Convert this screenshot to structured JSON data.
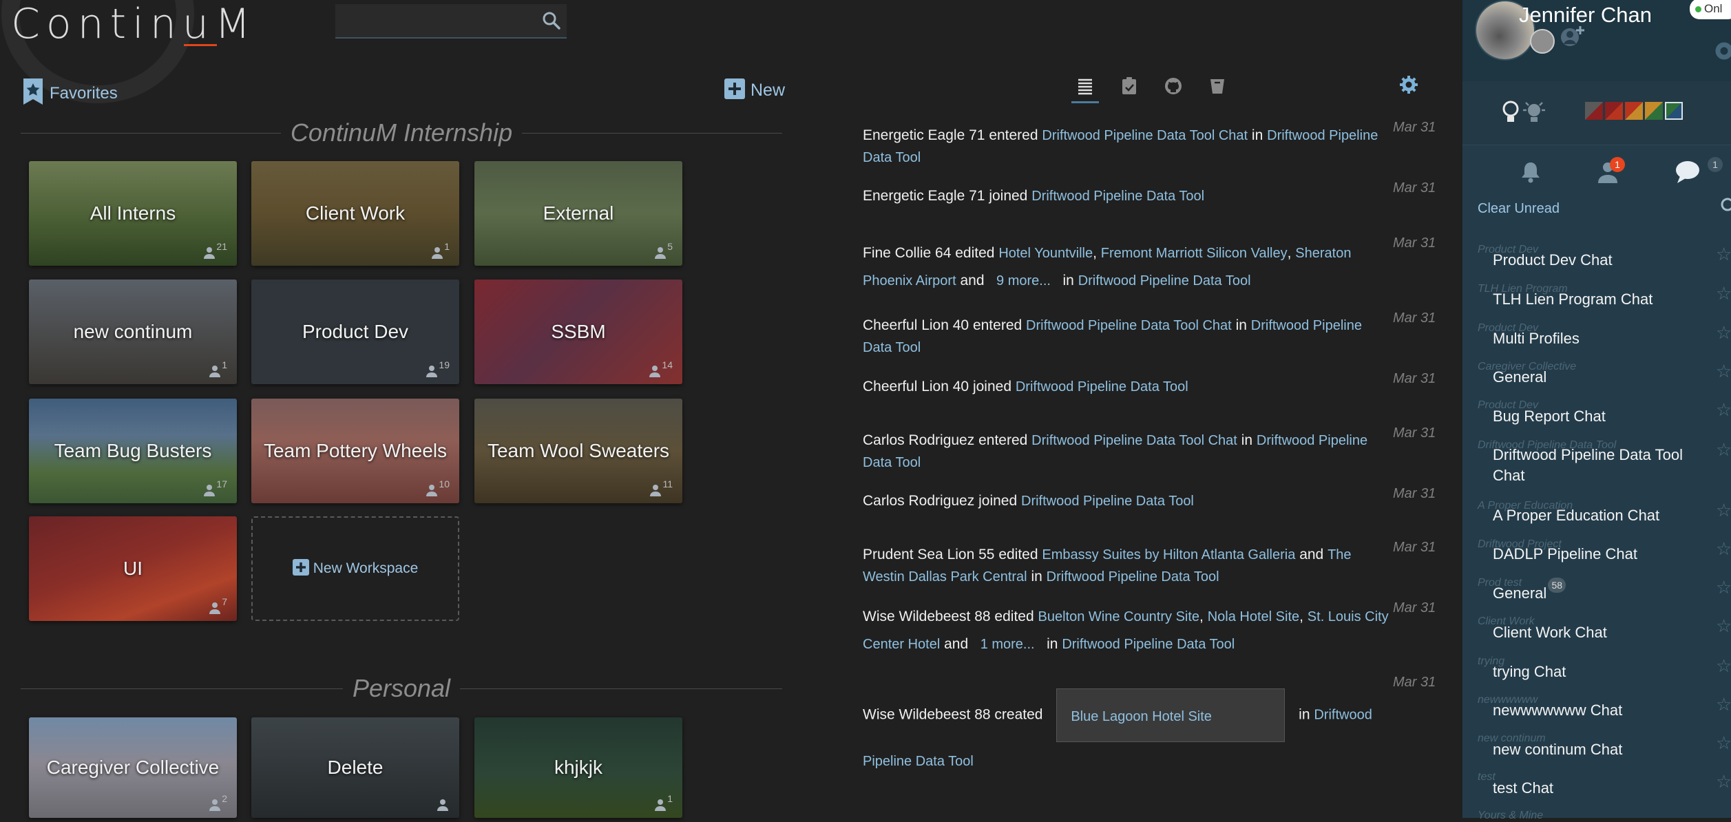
{
  "app": {
    "logo_text": "ContinuM"
  },
  "search": {
    "placeholder": ""
  },
  "left": {
    "favorites_label": "Favorites",
    "new_label": "New",
    "section_internship": "ContinuM Internship",
    "section_personal": "Personal",
    "new_workspace_label": "New Workspace",
    "tiles": [
      {
        "name": "All Interns",
        "members": "21"
      },
      {
        "name": "Client Work",
        "members": "1"
      },
      {
        "name": "External",
        "members": "5"
      },
      {
        "name": "new continum",
        "members": "1"
      },
      {
        "name": "Product Dev",
        "members": "19"
      },
      {
        "name": "SSBM",
        "members": "14"
      },
      {
        "name": "Team Bug Busters",
        "members": "17"
      },
      {
        "name": "Team Pottery Wheels",
        "members": "10"
      },
      {
        "name": "Team Wool Sweaters",
        "members": "11"
      },
      {
        "name": "UI",
        "members": "7"
      }
    ],
    "personal_tiles": [
      {
        "name": "Caregiver Collective",
        "members": "2"
      },
      {
        "name": "Delete",
        "members": ""
      },
      {
        "name": "khjkjk",
        "members": "1"
      }
    ]
  },
  "feed": {
    "entries": [
      {
        "date": "Mar 31",
        "actor": "Energetic Eagle 71",
        "verb": "entered",
        "target": "Driftwood Pipeline Data Tool Chat",
        "in": "in",
        "place": "Driftwood Pipeline Data Tool"
      },
      {
        "date": "Mar 31",
        "actor": "Energetic Eagle 71",
        "verb": "joined",
        "target": "Driftwood Pipeline Data Tool"
      },
      {
        "date": "Mar 31",
        "actor": "Fine Collie 64",
        "verb": "edited",
        "items": [
          "Hotel Yountville",
          "Fremont Marriott Silicon Valley",
          "Sheraton Phoenix Airport"
        ],
        "and": "and",
        "more": "9 more...",
        "in": "in",
        "place": "Driftwood Pipeline Data Tool"
      },
      {
        "date": "Mar 31",
        "actor": "Cheerful Lion 40",
        "verb": "entered",
        "target": "Driftwood Pipeline Data Tool Chat",
        "in": "in",
        "place": "Driftwood Pipeline Data Tool"
      },
      {
        "date": "Mar 31",
        "actor": "Cheerful Lion 40",
        "verb": "joined",
        "target": "Driftwood Pipeline Data Tool"
      },
      {
        "date": "Mar 31",
        "actor": "Carlos Rodriguez",
        "verb": "entered",
        "target": "Driftwood Pipeline Data Tool Chat",
        "in": "in",
        "place": "Driftwood Pipeline Data Tool"
      },
      {
        "date": "Mar 31",
        "actor": "Carlos Rodriguez",
        "verb": "joined",
        "target": "Driftwood Pipeline Data Tool"
      },
      {
        "date": "Mar 31",
        "actor": "Prudent Sea Lion 55",
        "verb": "edited",
        "items": [
          "Embassy Suites by Hilton Atlanta Galleria",
          "The Westin Dallas Park Central"
        ],
        "and": "and",
        "in": "in",
        "place": "Driftwood Pipeline Data Tool"
      },
      {
        "date": "Mar 31",
        "actor": "Wise Wildebeest 88",
        "verb": "edited",
        "items": [
          "Buelton Wine Country Site",
          "Nola Hotel Site",
          "St. Louis City Center Hotel"
        ],
        "and": "and",
        "more": "1 more...",
        "in": "in",
        "place": "Driftwood Pipeline Data Tool"
      },
      {
        "date": "Mar 31",
        "actor": "Wise Wildebeest 88",
        "verb": "created",
        "target": "Blue Lagoon Hotel Site",
        "in": "in",
        "place": "Driftwood Pipeline Data Tool"
      }
    ]
  },
  "user": {
    "name": "Jennifer Chan",
    "status": "Onl"
  },
  "panel": {
    "clear_unread": "Clear Unread",
    "people_badge": "1",
    "chat_badge": "1",
    "swatch_colors": [
      "#5a5a5a",
      "#8c1f1f",
      "#b8341e",
      "#c58b2a",
      "#2f6f3a",
      "#244f77"
    ],
    "chats": [
      {
        "sub": "Product Dev",
        "name": "Product Dev Chat"
      },
      {
        "sub": "TLH Lien Program",
        "name": "TLH Lien Program Chat"
      },
      {
        "sub": "Product Dev",
        "name": "Multi Profiles"
      },
      {
        "sub": "Caregiver Collective",
        "name": "General"
      },
      {
        "sub": "Product Dev",
        "name": "Bug Report Chat"
      },
      {
        "sub": "Driftwood Pipeline Data Tool",
        "name": "Driftwood Pipeline Data Tool Chat"
      },
      {
        "sub": "A Proper Education",
        "name": "A Proper Education Chat"
      },
      {
        "sub": "Driftwood Project",
        "name": "DADLP Pipeline Chat"
      },
      {
        "sub": "Prod test",
        "name": "General",
        "badge": "58"
      },
      {
        "sub": "Client Work",
        "name": "Client Work Chat"
      },
      {
        "sub": "trying",
        "name": "trying Chat"
      },
      {
        "sub": "newwwwww",
        "name": "newwwwwww Chat"
      },
      {
        "sub": "new continum",
        "name": "new continum Chat"
      },
      {
        "sub": "test",
        "name": "test Chat"
      },
      {
        "sub": "Yours & Mine",
        "name": ""
      }
    ]
  }
}
